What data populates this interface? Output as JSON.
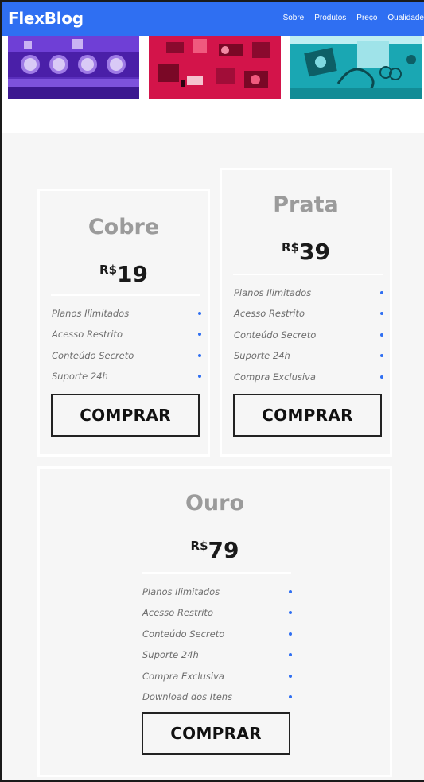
{
  "header": {
    "logo": "FlexBlog",
    "nav": [
      "Sobre",
      "Produtos",
      "Preço",
      "Qualidade"
    ]
  },
  "gallery": {
    "images": [
      "photo-purple",
      "photo-red",
      "photo-teal"
    ],
    "colors": [
      "#5a2fbd",
      "#d3144a",
      "#1aa7b3"
    ]
  },
  "pricing": {
    "currency": "R$",
    "buy_label": "COMPRAR",
    "plans": [
      {
        "name": "Cobre",
        "price": "19",
        "features": [
          "Planos Ilimitados",
          "Acesso Restrito",
          "Conteúdo Secreto",
          "Suporte 24h"
        ]
      },
      {
        "name": "Prata",
        "price": "39",
        "features": [
          "Planos Ilimitados",
          "Acesso Restrito",
          "Conteúdo Secreto",
          "Suporte 24h",
          "Compra Exclusiva"
        ]
      },
      {
        "name": "Ouro",
        "price": "79",
        "features": [
          "Planos Ilimitados",
          "Acesso Restrito",
          "Conteúdo Secreto",
          "Suporte 24h",
          "Compra Exclusiva",
          "Download dos Itens"
        ]
      }
    ]
  },
  "colors": {
    "accent": "#2f6ff2",
    "title_gray": "#9b9b9b",
    "background": "#f6f6f6"
  }
}
